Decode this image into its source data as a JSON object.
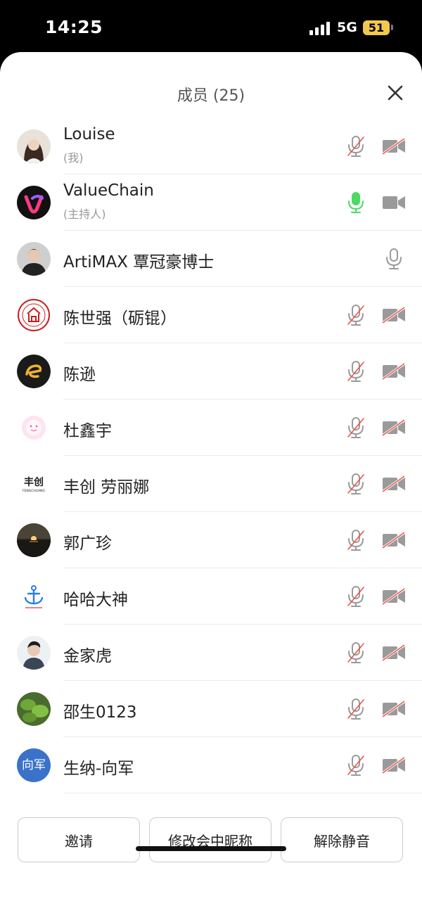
{
  "status": {
    "time": "14:25",
    "network": "5G",
    "battery": "51"
  },
  "header": {
    "title": "成员 (25)"
  },
  "members": [
    {
      "name": "Louise",
      "sub": "(我)",
      "mic": "muted",
      "cam": "off",
      "avatar": "photo-woman"
    },
    {
      "name": "ValueChain",
      "sub": "(主持人)",
      "mic": "active",
      "cam": "on",
      "avatar": "logo-valuechain"
    },
    {
      "name": "ArtiMAX 覃冠豪博士",
      "mic": "on",
      "cam": "none",
      "avatar": "photo-man"
    },
    {
      "name": "陈世强（砺锟）",
      "mic": "muted",
      "cam": "off",
      "avatar": "logo-seal"
    },
    {
      "name": "陈逊",
      "mic": "muted",
      "cam": "off",
      "avatar": "logo-e"
    },
    {
      "name": "杜鑫宇",
      "mic": "muted",
      "cam": "off",
      "avatar": "pink-face"
    },
    {
      "name": "丰创 劳丽娜",
      "mic": "muted",
      "cam": "off",
      "avatar": "logo-fengchuang",
      "avatar_text": "丰创",
      "avatar_sub": "FENGCHUANG"
    },
    {
      "name": "郭广珍",
      "mic": "muted",
      "cam": "off",
      "avatar": "photo-sunset"
    },
    {
      "name": "哈哈大神",
      "mic": "muted",
      "cam": "off",
      "avatar": "logo-anchor"
    },
    {
      "name": "金家虎",
      "mic": "muted",
      "cam": "off",
      "avatar": "photo-man2"
    },
    {
      "name": "邵生0123",
      "mic": "muted",
      "cam": "off",
      "avatar": "photo-plant"
    },
    {
      "name": "生纳-向军",
      "mic": "muted",
      "cam": "off",
      "avatar": "text-avatar",
      "avatar_text": "向军"
    }
  ],
  "footer": {
    "invite_label": "邀请",
    "rename_label": "修改会中昵称",
    "unmute_label": "解除静音"
  },
  "colors": {
    "active_mic": "#4cd964",
    "muted_slash": "#e8574e",
    "icon_gray": "#9a9a9a"
  }
}
